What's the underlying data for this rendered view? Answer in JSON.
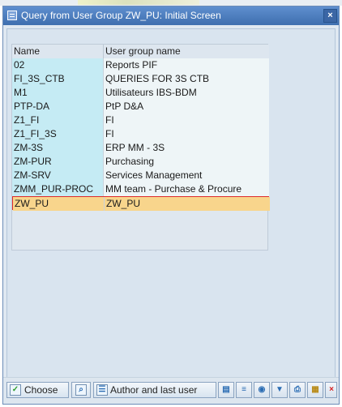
{
  "window": {
    "title": "Query from User Group ZW_PU: Initial Screen",
    "close_label": "×"
  },
  "table": {
    "columns": [
      "Name",
      "User group name"
    ],
    "rows": [
      [
        "02",
        "Reports PIF"
      ],
      [
        "FI_3S_CTB",
        "QUERIES FOR 3S CTB"
      ],
      [
        "M1",
        "Utilisateurs IBS-BDM"
      ],
      [
        "PTP-DA",
        "PtP D&A"
      ],
      [
        "Z1_FI",
        "FI"
      ],
      [
        "Z1_FI_3S",
        "FI"
      ],
      [
        "ZM-3S",
        "ERP MM - 3S"
      ],
      [
        "ZM-PUR",
        "Purchasing"
      ],
      [
        "ZM-SRV",
        "Services Management"
      ],
      [
        "ZMM_PUR-PROC",
        "MM team - Purchase & Procure"
      ],
      [
        "ZW_PU",
        "ZW_PU"
      ]
    ],
    "selected_index": 10
  },
  "footer": {
    "choose_label": "Choose",
    "author_label": "Author and last user",
    "icons": [
      "save-icon",
      "filter-icon",
      "find-icon",
      "sort-icon",
      "print-icon",
      "grid-icon",
      "cancel-icon"
    ]
  },
  "colors": {
    "title_bar": "#4f7fc0",
    "name_cell": "#c5ebf4",
    "selected_row": "#f8d58c",
    "selected_border": "#dd2b2b"
  }
}
